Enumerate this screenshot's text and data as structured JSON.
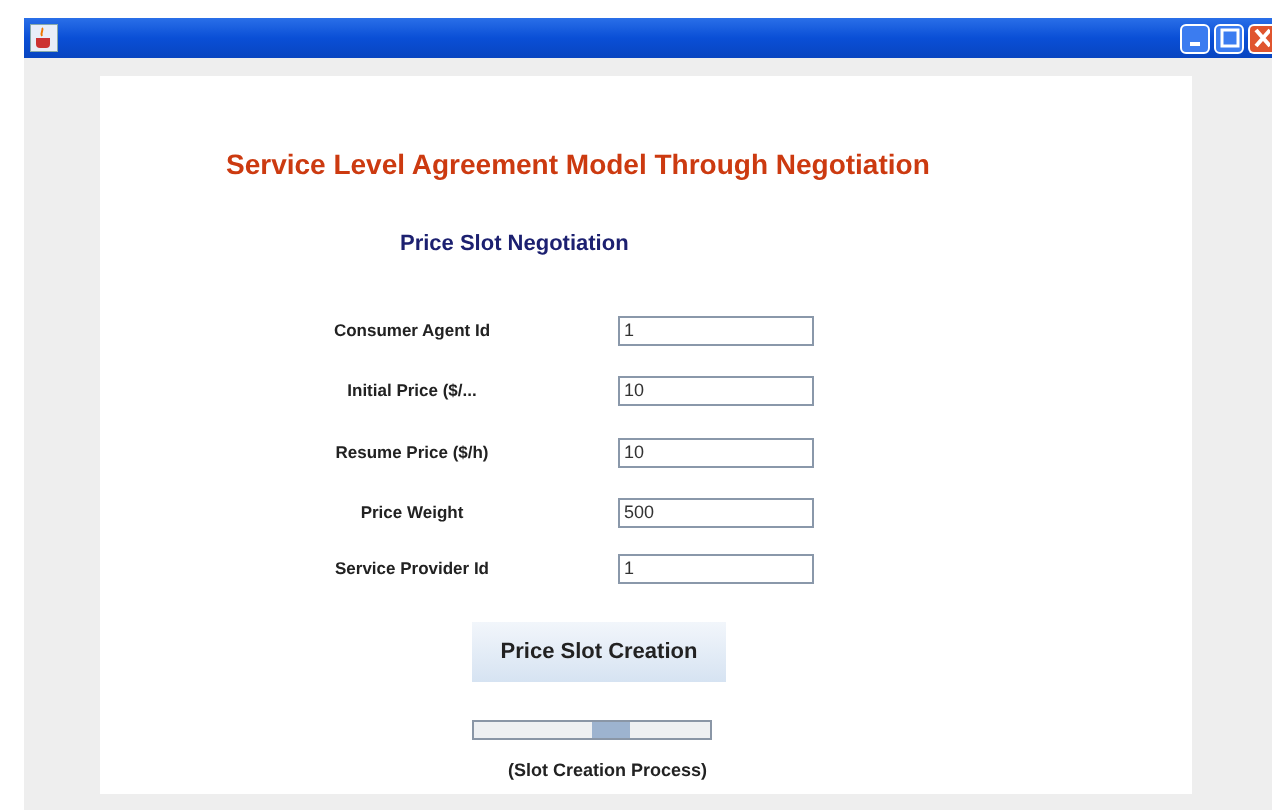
{
  "heading": "Service Level Agreement Model Through Negotiation",
  "subheading": "Price Slot Negotiation",
  "fields": [
    {
      "label": "Consumer Agent Id",
      "value": "1"
    },
    {
      "label": "Initial Price ($/...",
      "value": "10"
    },
    {
      "label": "Resume Price ($/h)",
      "value": "10"
    },
    {
      "label": "Price Weight",
      "value": "500"
    },
    {
      "label": "Service Provider Id",
      "value": "1"
    }
  ],
  "button": "Price Slot Creation",
  "progress_caption": "(Slot Creation Process)"
}
